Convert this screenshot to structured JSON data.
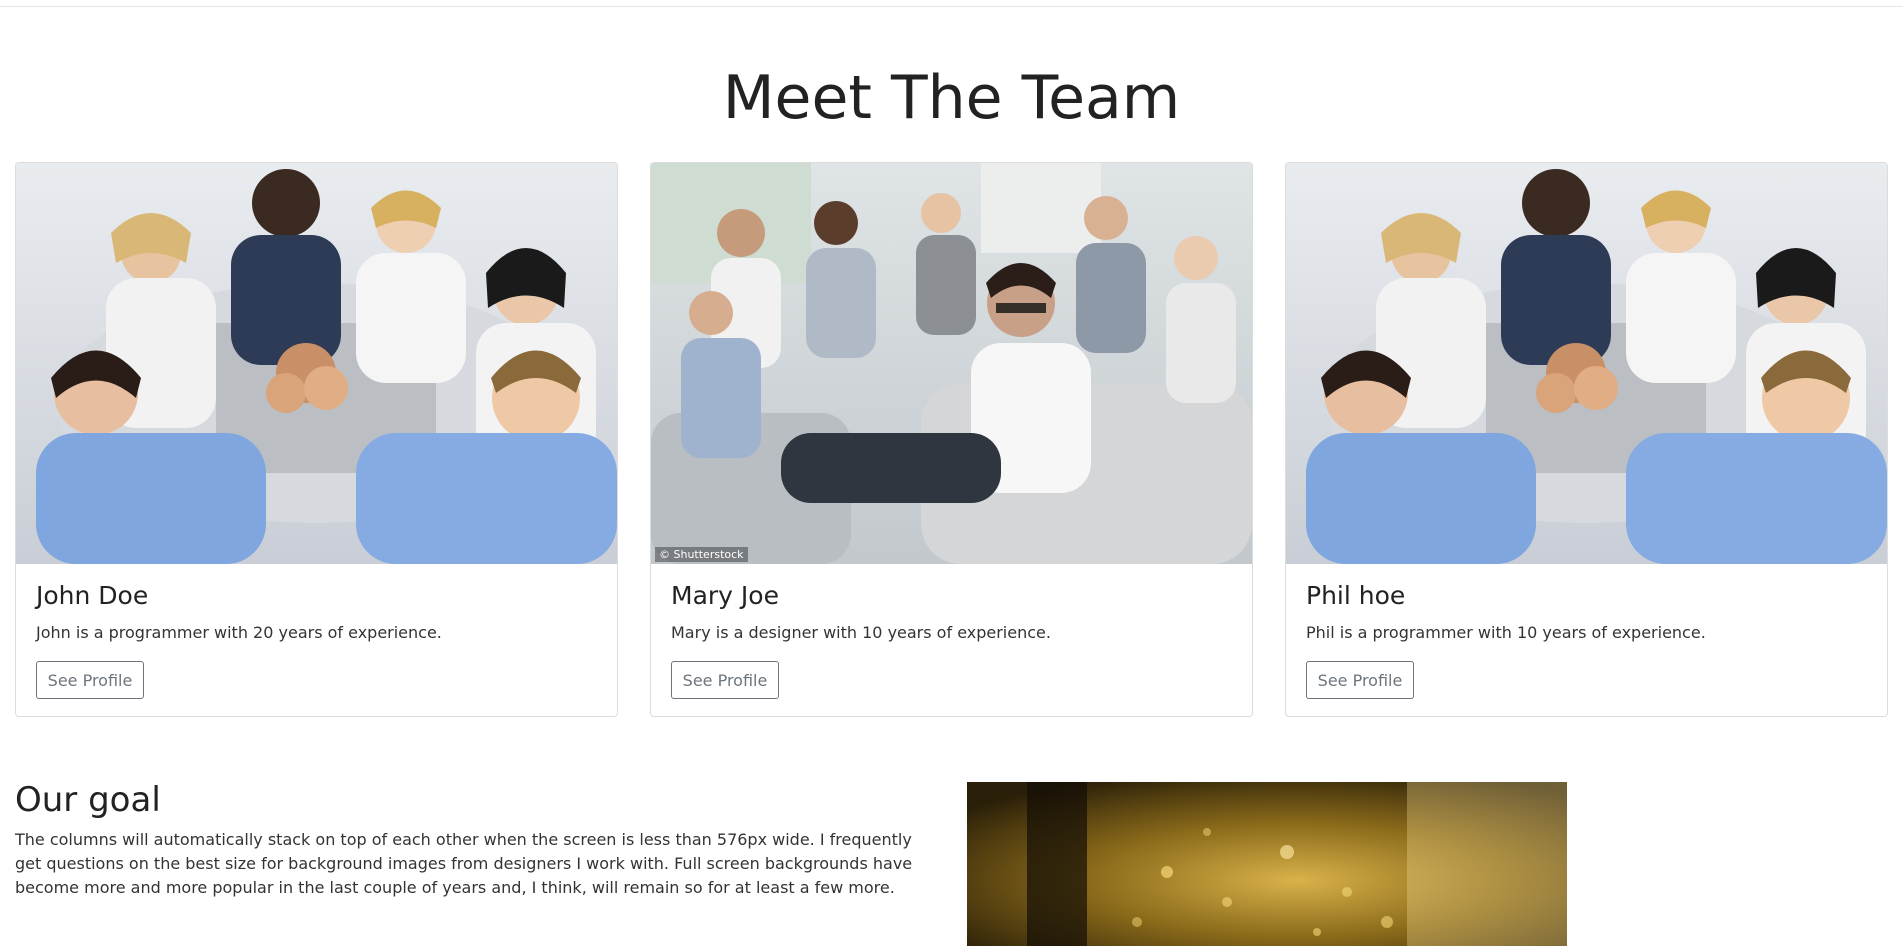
{
  "page": {
    "heading": "Meet The Team"
  },
  "team": [
    {
      "name": "John Doe",
      "description": "John is a programmer with 20 years of experience.",
      "button_label": "See Profile",
      "photo": "group-hands-together-photo"
    },
    {
      "name": "Mary Joe",
      "description": "Mary is a designer with 10 years of experience.",
      "button_label": "See Profile",
      "photo": "team-meeting-sofa-photo",
      "watermark": "© Shutterstock"
    },
    {
      "name": "Phil hoe",
      "description": "Phil is a programmer with 10 years of experience.",
      "button_label": "See Profile",
      "photo": "group-hands-together-photo"
    }
  ],
  "goal": {
    "heading": "Our goal",
    "text": "The columns will automatically stack on top of each other when the screen is less than 576px wide. I frequently get questions on the best size for background images from designers I work with. Full screen backgrounds have become more and more popular in the last couple of years and, I think, will remain so for at least a few more.",
    "image": "golden-bokeh-background-photo"
  },
  "colors": {
    "heading": "#222222",
    "button_border": "#6c757d",
    "card_border": "#dcdcdc"
  }
}
